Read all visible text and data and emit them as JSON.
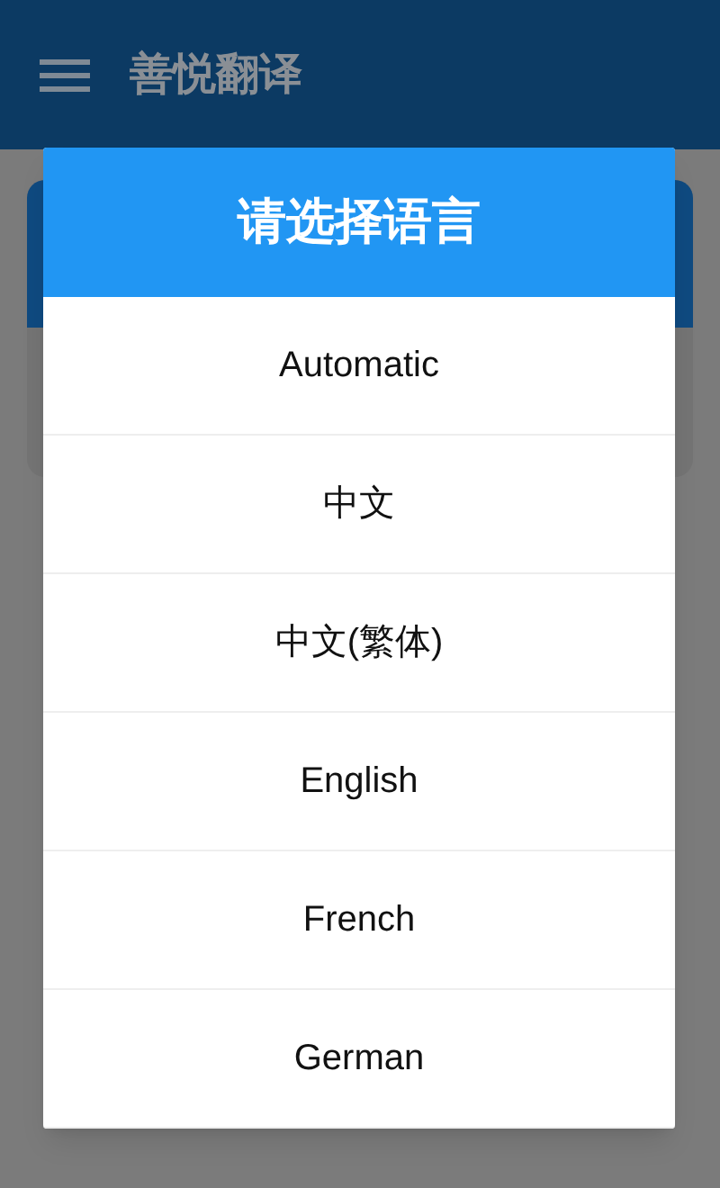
{
  "app_bar": {
    "title": "善悦翻译"
  },
  "dialog": {
    "title": "请选择语言",
    "options": [
      {
        "label": "Automatic"
      },
      {
        "label": "中文"
      },
      {
        "label": "中文(繁体)"
      },
      {
        "label": "English"
      },
      {
        "label": "French"
      },
      {
        "label": "German"
      }
    ]
  }
}
